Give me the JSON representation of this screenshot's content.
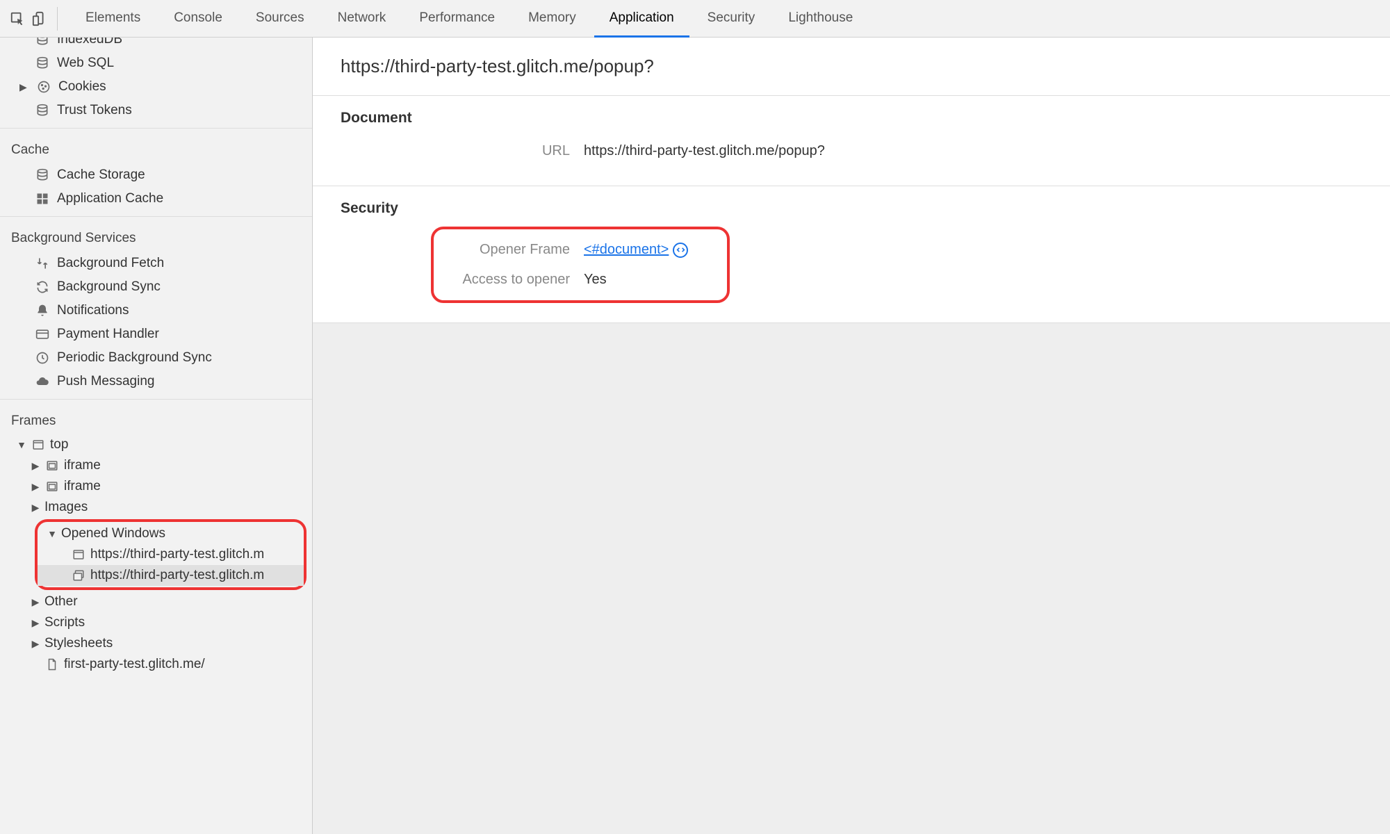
{
  "tabs": [
    "Elements",
    "Console",
    "Sources",
    "Network",
    "Performance",
    "Memory",
    "Application",
    "Security",
    "Lighthouse"
  ],
  "active_tab": "Application",
  "sidebar": {
    "storage": {
      "items": [
        "IndexedDB",
        "Web SQL",
        "Cookies",
        "Trust Tokens"
      ]
    },
    "cache": {
      "title": "Cache",
      "items": [
        "Cache Storage",
        "Application Cache"
      ]
    },
    "bg": {
      "title": "Background Services",
      "items": [
        "Background Fetch",
        "Background Sync",
        "Notifications",
        "Payment Handler",
        "Periodic Background Sync",
        "Push Messaging"
      ]
    },
    "frames": {
      "title": "Frames",
      "top": "top",
      "iframe": "iframe",
      "images": "Images",
      "opened_windows": "Opened Windows",
      "ow_items": [
        "https://third-party-test.glitch.m",
        "https://third-party-test.glitch.m"
      ],
      "other": "Other",
      "scripts": "Scripts",
      "stylesheets": "Stylesheets",
      "leaf": "first-party-test.glitch.me/"
    }
  },
  "main": {
    "title_url": "https://third-party-test.glitch.me/popup?",
    "document": {
      "heading": "Document",
      "url_label": "URL",
      "url_value": "https://third-party-test.glitch.me/popup?"
    },
    "security": {
      "heading": "Security",
      "opener_frame_label": "Opener Frame",
      "opener_frame_value": "<#document>",
      "access_label": "Access to opener",
      "access_value": "Yes"
    }
  }
}
